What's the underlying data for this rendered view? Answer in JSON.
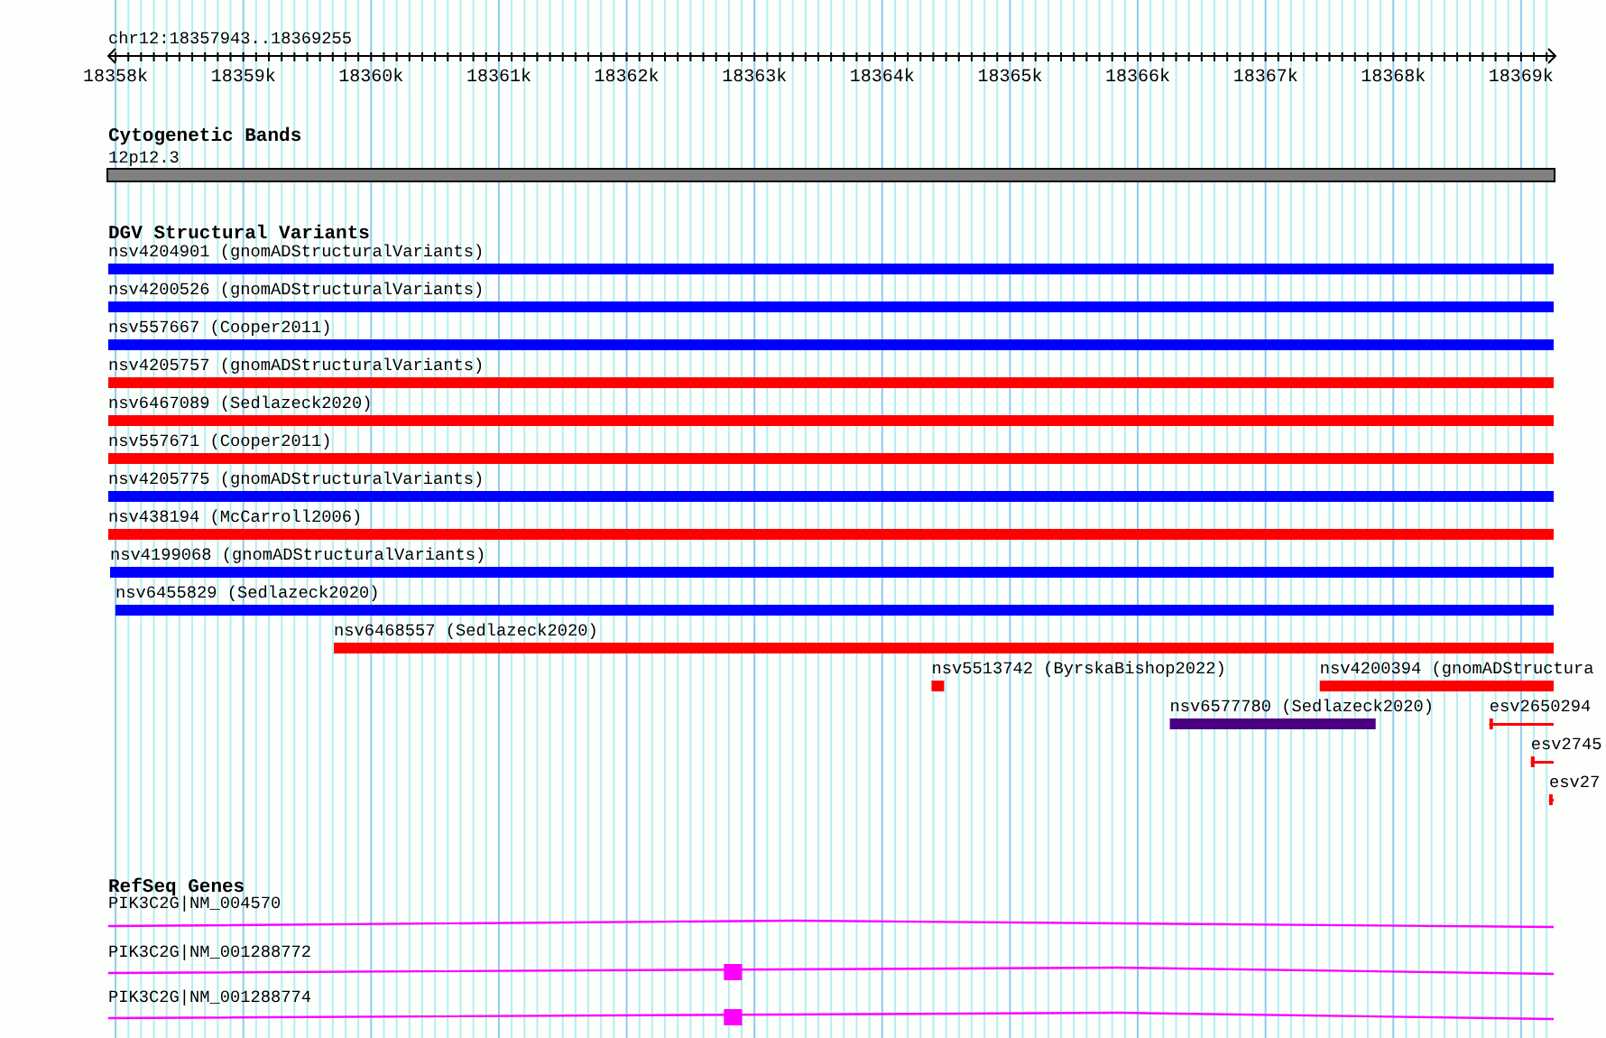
{
  "ruler": {
    "location": "chr12:18357943..18369255",
    "ticks": [
      "18358k",
      "18359k",
      "18360k",
      "18361k",
      "18362k",
      "18363k",
      "18364k",
      "18365k",
      "18366k",
      "18367k",
      "18368k",
      "18369k"
    ]
  },
  "cytoband_track": {
    "title": "Cytogenetic Bands",
    "band": "12p12.3"
  },
  "variant_track": {
    "title": "DGV Structural Variants",
    "rows": [
      [
        {
          "label": "nsv4204901 (gnomADStructuralVariants)",
          "kind": "bar",
          "color": "#0000ff"
        }
      ],
      [
        {
          "label": "nsv4200526 (gnomADStructuralVariants)",
          "kind": "bar",
          "color": "#0000ff"
        }
      ],
      [
        {
          "label": "nsv557667 (Cooper2011)",
          "kind": "bar",
          "color": "#0000ff"
        }
      ],
      [
        {
          "label": "nsv4205757 (gnomADStructuralVariants)",
          "kind": "bar",
          "color": "#ff0000"
        }
      ],
      [
        {
          "label": "nsv6467089 (Sedlazeck2020)",
          "kind": "bar",
          "color": "#ff0000"
        }
      ],
      [
        {
          "label": "nsv557671 (Cooper2011)",
          "kind": "bar",
          "color": "#ff0000"
        }
      ],
      [
        {
          "label": "nsv4205775 (gnomADStructuralVariants)",
          "kind": "bar",
          "color": "#0000ff"
        }
      ],
      [
        {
          "label": "nsv438194 (McCarroll2006)",
          "kind": "bar",
          "color": "#ff0000"
        }
      ],
      [
        {
          "label": "nsv4199068 (gnomADStructuralVariants)",
          "kind": "bar",
          "color": "#0000ff"
        }
      ],
      [
        {
          "label": "nsv6455829 (Sedlazeck2020)",
          "kind": "bar",
          "color": "#0000ff"
        }
      ],
      [
        {
          "label": "nsv6468557 (Sedlazeck2020)",
          "kind": "bar",
          "color": "#ff0000"
        }
      ],
      [
        {
          "label": "nsv5513742 (ByrskaBishop2022)",
          "kind": "bar",
          "color": "#ff0000"
        },
        {
          "label": "nsv4200394 (gnomADStructura",
          "kind": "bar",
          "color": "#ff0000"
        }
      ],
      [
        {
          "label": "nsv6577780 (Sedlazeck2020)",
          "kind": "bar",
          "color": "#4b0082"
        },
        {
          "label": "esv2650294",
          "kind": "line",
          "color": "#ff0000"
        }
      ],
      [
        {
          "label": "esv2745",
          "kind": "line",
          "color": "#ff0000"
        }
      ],
      [
        {
          "label": "esv27",
          "kind": "line",
          "color": "#ff0000"
        }
      ]
    ]
  },
  "gene_track": {
    "title": "RefSeq Genes",
    "transcripts": [
      {
        "label": "PIK3C2G|NM_004570"
      },
      {
        "label": "PIK3C2G|NM_001288772"
      },
      {
        "label": "PIK3C2G|NM_001288774"
      }
    ]
  }
}
